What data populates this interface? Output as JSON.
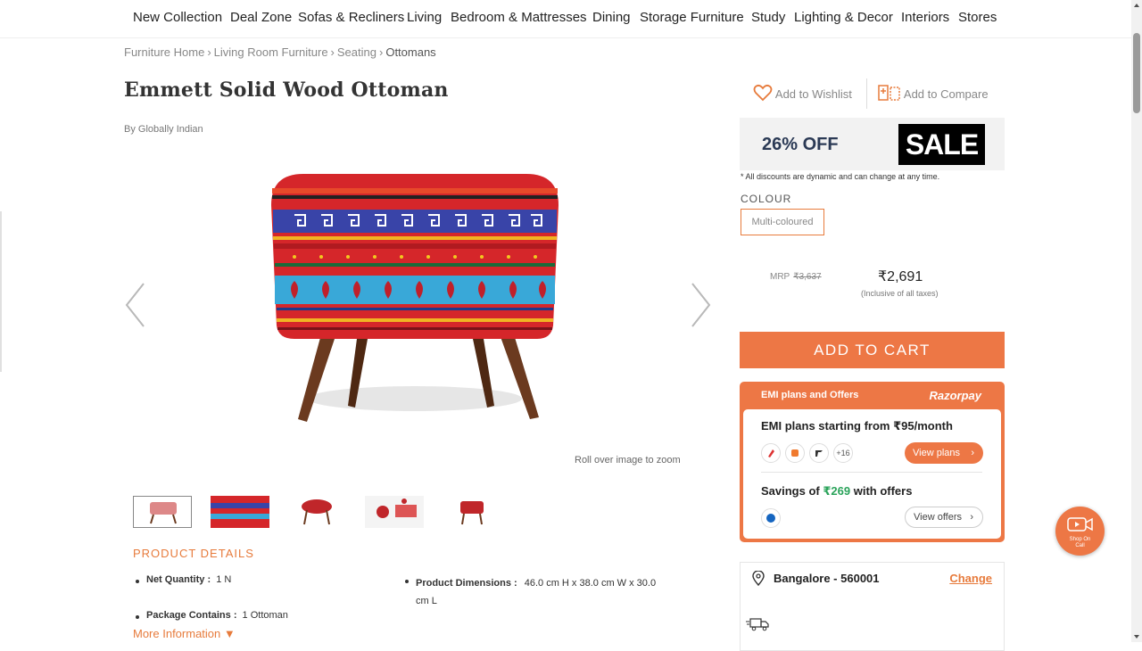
{
  "nav": {
    "items": [
      "New Collection",
      "Deal Zone",
      "Sofas & Recliners",
      "Living",
      "Bedroom & Mattresses",
      "Dining",
      "Storage Furniture",
      "Study",
      "Lighting & Decor",
      "Interiors",
      "Stores"
    ]
  },
  "breadcrumb": {
    "items": [
      "Furniture Home",
      "Living Room Furniture",
      "Seating"
    ],
    "separator": "›",
    "current": "Ottomans"
  },
  "product": {
    "title": "Emmett Solid Wood Ottoman",
    "brand": "By Globally Indian",
    "zoom_hint": "Roll over image to zoom"
  },
  "details": {
    "heading": "PRODUCT DETAILS",
    "net_quantity_label": "Net Quantity :",
    "net_quantity_value": "1 N",
    "dimensions_label": "Product Dimensions :",
    "dimensions_value_line1": "46.0 cm H x 38.0 cm W x 30.0",
    "dimensions_value_line2": "cm L",
    "package_label": "Package Contains :",
    "package_value": "1 Ottoman",
    "more_info": "More Information ▼"
  },
  "actions": {
    "wishlist": "Add to Wishlist",
    "compare": "Add to Compare"
  },
  "offer": {
    "discount": "26% OFF",
    "sale_badge": "SALE",
    "note": "* All discounts are dynamic and can change at any time."
  },
  "colour": {
    "label": "COLOUR",
    "selected": "Multi-coloured"
  },
  "pricing": {
    "mrp_label": "MRP",
    "mrp": "₹3,637",
    "price": "₹2,691",
    "tax_note": "(Inclusive of all taxes)"
  },
  "cart": {
    "label": "ADD TO CART"
  },
  "emi": {
    "header": "EMI plans and Offers",
    "provider": "Razorpay",
    "plans_text": "EMI plans starting from ₹95/month",
    "more_count": "+16",
    "view_plans": "View plans",
    "savings_prefix": "Savings of ",
    "savings_amount": "₹269",
    "savings_suffix": " with offers",
    "view_offers": "View offers"
  },
  "location": {
    "city": "Bangalore - 560001",
    "change": "Change"
  },
  "shop_on_call": {
    "line1": "Shop On",
    "line2": "Call"
  },
  "colors": {
    "accent": "#ed7745",
    "navy": "#2b3a55",
    "green": "#2aa35a"
  }
}
